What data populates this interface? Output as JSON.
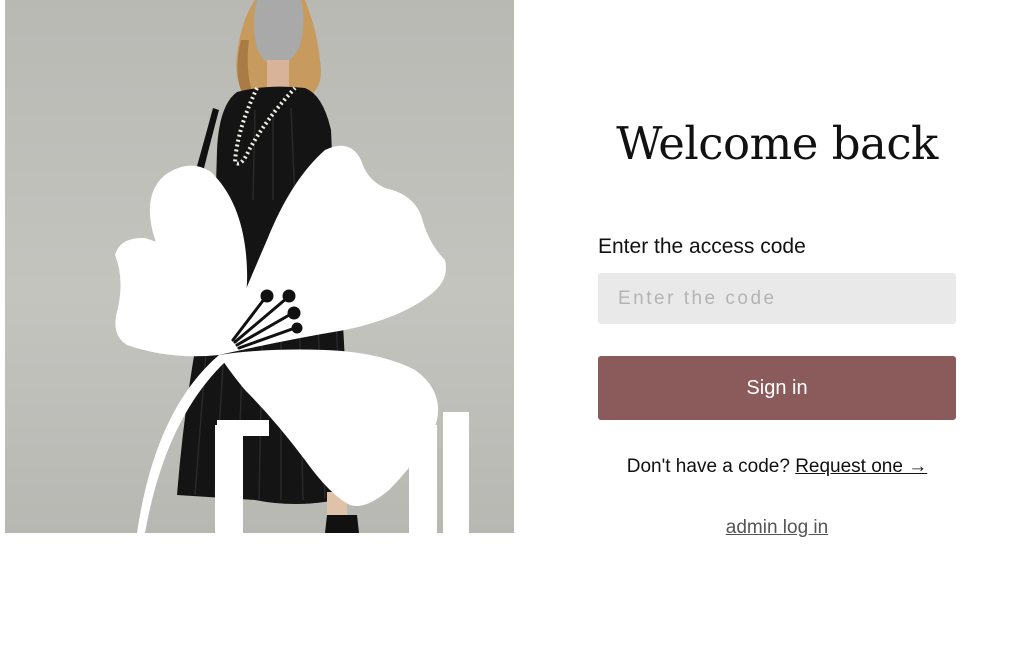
{
  "hero": {
    "image": "fashion-model-photo",
    "logo_icon": "flower-logo-icon"
  },
  "form": {
    "title": "Welcome back",
    "label": "Enter the access code",
    "input_placeholder": "Enter the code",
    "input_value": "",
    "submit_label": "Sign in",
    "request_prompt": "Don't have a code?",
    "request_link": "Request one →",
    "admin_link": "admin log in"
  },
  "colors": {
    "button": "#8b5b5c",
    "input_bg": "#e9e9e9",
    "hero_bg": "#c0c0bb"
  }
}
